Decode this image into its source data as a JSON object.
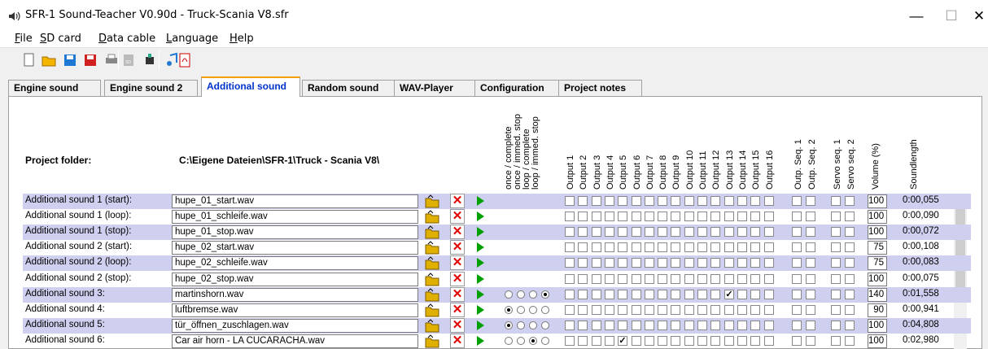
{
  "window": {
    "title": "SFR-1 Sound-Teacher V0.90d - Truck-Scania V8.sfr"
  },
  "menu": [
    "File",
    "SD card",
    "Data cable",
    "Language",
    "Help"
  ],
  "toolbar": [
    "new-icon",
    "open-icon",
    "save-icon",
    "save-as-icon",
    "print-icon",
    "sd-card-icon",
    "data-cable-icon",
    "sound-icon",
    "pdf-icon"
  ],
  "tabs": [
    {
      "label": "Engine sound",
      "active": false
    },
    {
      "label": "Engine sound 2",
      "active": false
    },
    {
      "label": "Additional sound",
      "active": true
    },
    {
      "label": "Random sound",
      "active": false
    },
    {
      "label": "WAV-Player",
      "active": false
    },
    {
      "label": "Configuration",
      "active": false
    },
    {
      "label": "Project notes",
      "active": false
    }
  ],
  "project": {
    "label": "Project folder:",
    "path": "C:\\Eigene Dateien\\SFR-1\\Truck - Scania V8\\"
  },
  "headers": {
    "modes": [
      "once / complete",
      "once / immed. stop",
      "loop / complete",
      "loop / immed. stop"
    ],
    "outputs": [
      "Output 1",
      "Output 2",
      "Output 3",
      "Output 4",
      "Output 5",
      "Output 6",
      "Output 7",
      "Output 8",
      "Output 9",
      "Output 10",
      "Output 11",
      "Output 12",
      "Output 13",
      "Output 14",
      "Output 15",
      "Output 16"
    ],
    "outp_seq": [
      "Outp. Seq. 1",
      "Outp. Seq. 2"
    ],
    "servo_seq": [
      "Servo seq. 1",
      "Servo seq. 2"
    ],
    "volume": "Volume (%)",
    "length": "Soundlength"
  },
  "rows": [
    {
      "label": "Additional sound 1 (start):",
      "file": "hupe_01_start.wav",
      "mode": null,
      "outputs_on": [],
      "volume": "100",
      "length": "0:00,055"
    },
    {
      "label": "Additional sound 1 (loop):",
      "file": "hupe_01_schleife.wav",
      "mode": null,
      "outputs_on": [],
      "volume": "100",
      "length": "0:00,090"
    },
    {
      "label": "Additional sound 1 (stop):",
      "file": "hupe_01_stop.wav",
      "mode": null,
      "outputs_on": [],
      "volume": "100",
      "length": "0:00,072"
    },
    {
      "label": "Additional sound 2 (start):",
      "file": "hupe_02_start.wav",
      "mode": null,
      "outputs_on": [],
      "volume": "75",
      "length": "0:00,108"
    },
    {
      "label": "Additional sound 2 (loop):",
      "file": "hupe_02_schleife.wav",
      "mode": null,
      "outputs_on": [],
      "volume": "75",
      "length": "0:00,083"
    },
    {
      "label": "Additional sound 2 (stop):",
      "file": "hupe_02_stop.wav",
      "mode": null,
      "outputs_on": [],
      "volume": "100",
      "length": "0:00,075"
    },
    {
      "label": "Additional sound 3:",
      "file": "martinshorn.wav",
      "mode": 3,
      "outputs_on": [
        13
      ],
      "volume": "140",
      "length": "0:01,558"
    },
    {
      "label": "Additional sound 4:",
      "file": "luftbremse.wav",
      "mode": 0,
      "outputs_on": [],
      "volume": "90",
      "length": "0:00,941"
    },
    {
      "label": "Additional sound 5:",
      "file": "tür_öffnen_zuschlagen.wav",
      "mode": 0,
      "outputs_on": [],
      "volume": "100",
      "length": "0:04,808"
    },
    {
      "label": "Additional sound 6:",
      "file": "Car air horn - LA CUCARACHA.wav",
      "mode": 2,
      "outputs_on": [
        5
      ],
      "volume": "100",
      "length": "0:02,980"
    }
  ]
}
